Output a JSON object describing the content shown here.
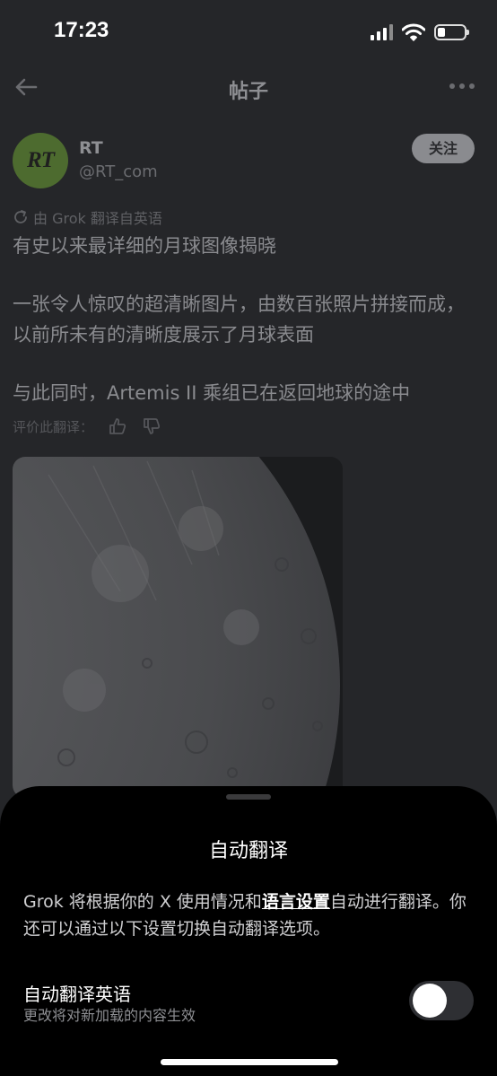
{
  "status_bar": {
    "time": "17:23",
    "battery_level": 0.3,
    "icons": [
      "cellular-signal-icon",
      "wifi-icon",
      "battery-icon"
    ]
  },
  "nav": {
    "title": "帖子",
    "back_icon": "arrow-left-icon",
    "more_icon": "more-horizontal-icon"
  },
  "post": {
    "author": {
      "avatar_text": "RT",
      "name": "RT",
      "handle": "@RT_com"
    },
    "follow_label": "关注",
    "translated_by": "由 Grok 翻译自英语",
    "paragraphs": [
      "有史以来最详细的月球图像揭晓",
      "一张令人惊叹的超清晰图片，由数百张照片拼接而成，以前所未有的清晰度展示了月球表面",
      "与此同时，Artemis II 乘组已在返回地球的途中"
    ],
    "rate_translation_label": "评价此翻译："
  },
  "sheet": {
    "title": "自动翻译",
    "desc_prefix": "Grok 将根据你的 X 使用情况和",
    "desc_link": "语言设置",
    "desc_suffix": "自动进行翻译。你还可以通过以下设置切换自动翻译选项。",
    "toggle_label": "自动翻译英语",
    "toggle_sub": "更改将对新加载的内容生效",
    "toggle_on": false
  },
  "colors": {
    "background": "#252629",
    "sheet": "#000000",
    "muted_text": "#8a8b8f"
  }
}
